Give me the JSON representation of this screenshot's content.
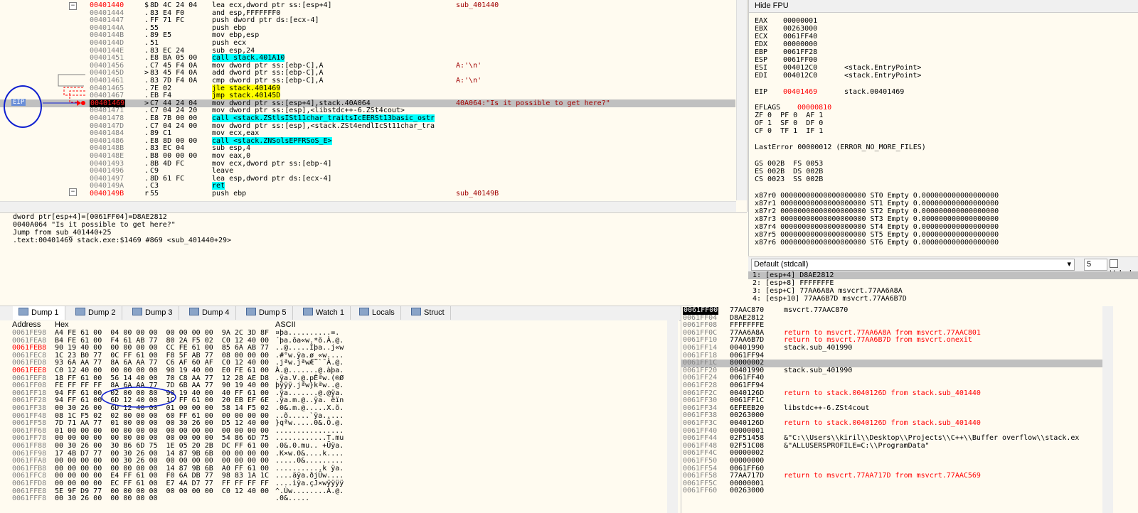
{
  "disasm": {
    "rows": [
      {
        "addr": "00401440",
        "addr_style": "red",
        "mark": "$",
        "bytes": "8D 4C 24 04",
        "instr": "lea ecx,dword ptr ss:[esp+4]",
        "cmt": "sub_401440",
        "hl": ""
      },
      {
        "addr": "00401444",
        "addr_style": "",
        "mark": ".",
        "bytes": "83 E4 F0",
        "instr": "and esp,FFFFFFF0",
        "cmt": "",
        "hl": ""
      },
      {
        "addr": "00401447",
        "addr_style": "",
        "mark": ".",
        "bytes": "FF 71 FC",
        "instr": "push dword ptr ds:[ecx-4]",
        "cmt": "",
        "hl": ""
      },
      {
        "addr": "0040144A",
        "addr_style": "",
        "mark": ".",
        "bytes": "55",
        "instr": "push ebp",
        "cmt": "",
        "hl": ""
      },
      {
        "addr": "0040144B",
        "addr_style": "",
        "mark": ".",
        "bytes": "89 E5",
        "instr": "mov ebp,esp",
        "cmt": "",
        "hl": ""
      },
      {
        "addr": "0040144D",
        "addr_style": "",
        "mark": ".",
        "bytes": "51",
        "instr": "push ecx",
        "cmt": "",
        "hl": ""
      },
      {
        "addr": "0040144E",
        "addr_style": "",
        "mark": ".",
        "bytes": "83 EC 24",
        "instr": "sub esp,24",
        "cmt": "",
        "hl": ""
      },
      {
        "addr": "00401451",
        "addr_style": "",
        "mark": ".",
        "bytes": "E8 BA 05 00",
        "instr": "call stack.401A10",
        "cmt": "",
        "hl": "call"
      },
      {
        "addr": "00401456",
        "addr_style": "",
        "mark": ".",
        "bytes": "C7 45 F4 0A",
        "instr": "mov dword ptr ss:[ebp-C],A",
        "cmt": "A:'\\n'",
        "hl": ""
      },
      {
        "addr": "0040145D",
        "addr_style": "",
        "mark": ">",
        "bytes": "83 45 F4 0A",
        "instr": "add dword ptr ss:[ebp-C],A",
        "cmt": "",
        "hl": ""
      },
      {
        "addr": "00401461",
        "addr_style": "",
        "mark": ".",
        "bytes": "83 7D F4 0A",
        "instr": "cmp dword ptr ss:[ebp-C],A",
        "cmt": "A:'\\n'",
        "hl": ""
      },
      {
        "addr": "00401465",
        "addr_style": "",
        "mark": ".",
        "bytes": "7E 02",
        "instr": "jle stack.401469",
        "cmt": "",
        "hl": "jmp"
      },
      {
        "addr": "00401467",
        "addr_style": "",
        "mark": ".",
        "bytes": "EB F4",
        "instr": "jmp stack.40145D",
        "cmt": "",
        "hl": "jmp"
      },
      {
        "addr": "00401469",
        "addr_style": "eip",
        "mark": ">",
        "bytes": "C7 44 24 04",
        "instr": "mov dword ptr ss:[esp+4],stack.40A064",
        "cmt": "40A064:\"Is it possible to get here?\"",
        "hl": "sel"
      },
      {
        "addr": "00401471",
        "addr_style": "",
        "mark": ".",
        "bytes": "C7 04 24 20",
        "instr": "mov dword ptr ss:[esp],<libstdc++-6.ZSt4cout>",
        "cmt": "",
        "hl": ""
      },
      {
        "addr": "00401478",
        "addr_style": "",
        "mark": ".",
        "bytes": "E8 7B 00 00",
        "instr": "call <stack.ZStlsISt11char_traitsIcEERSt13basic_ostr",
        "cmt": "",
        "hl": "call"
      },
      {
        "addr": "0040147D",
        "addr_style": "",
        "mark": ".",
        "bytes": "C7 04 24 00",
        "instr": "mov dword ptr ss:[esp],<stack.ZSt4endlIcSt11char_tra",
        "cmt": "",
        "hl": ""
      },
      {
        "addr": "00401484",
        "addr_style": "",
        "mark": ".",
        "bytes": "89 C1",
        "instr": "mov ecx,eax",
        "cmt": "",
        "hl": ""
      },
      {
        "addr": "00401486",
        "addr_style": "",
        "mark": ".",
        "bytes": "E8 8D 00 00",
        "instr": "call <stack.ZNSolsEPFRSoS_E>",
        "cmt": "",
        "hl": "call"
      },
      {
        "addr": "0040148B",
        "addr_style": "",
        "mark": ".",
        "bytes": "83 EC 04",
        "instr": "sub esp,4",
        "cmt": "",
        "hl": ""
      },
      {
        "addr": "0040148E",
        "addr_style": "",
        "mark": ".",
        "bytes": "B8 00 00 00",
        "instr": "mov eax,0",
        "cmt": "",
        "hl": ""
      },
      {
        "addr": "00401493",
        "addr_style": "",
        "mark": ".",
        "bytes": "8B 4D FC",
        "instr": "mov ecx,dword ptr ss:[ebp-4]",
        "cmt": "",
        "hl": ""
      },
      {
        "addr": "00401496",
        "addr_style": "",
        "mark": ".",
        "bytes": "C9",
        "instr": "leave",
        "cmt": "",
        "hl": ""
      },
      {
        "addr": "00401497",
        "addr_style": "",
        "mark": ".",
        "bytes": "8D 61 FC",
        "instr": "lea esp,dword ptr ds:[ecx-4]",
        "cmt": "",
        "hl": ""
      },
      {
        "addr": "0040149A",
        "addr_style": "",
        "mark": ".",
        "bytes": "C3",
        "instr": "ret",
        "cmt": "",
        "hl": "ret"
      },
      {
        "addr": "0040149B",
        "addr_style": "red",
        "mark": "r",
        "bytes": "55",
        "instr": "push ebp",
        "cmt": "sub_40149B",
        "hl": ""
      }
    ],
    "eip_label": "EIP"
  },
  "info": {
    "lines": [
      "dword ptr[esp+4]=[0061FF04]=D8AE2812",
      "0040A064 \"Is it possible to get here?\"",
      "Jump from sub_401440+25",
      ".text:00401469 stack.exe:$1469 #869 <sub_401440+29>"
    ]
  },
  "registers": {
    "header": "Hide FPU",
    "general": [
      {
        "name": "EAX",
        "value": "00000001",
        "note": ""
      },
      {
        "name": "EBX",
        "value": "00263000",
        "note": ""
      },
      {
        "name": "ECX",
        "value": "0061FF40",
        "note": ""
      },
      {
        "name": "EDX",
        "value": "00000000",
        "note": ""
      },
      {
        "name": "EBP",
        "value": "0061FF28",
        "note": ""
      },
      {
        "name": "ESP",
        "value": "0061FF00",
        "note": ""
      },
      {
        "name": "ESI",
        "value": "004012C0",
        "note": "<stack.EntryPoint>"
      },
      {
        "name": "EDI",
        "value": "004012C0",
        "note": "<stack.EntryPoint>"
      }
    ],
    "eip": {
      "name": "EIP",
      "value": "00401469",
      "note": "stack.00401469"
    },
    "eflags": {
      "name": "EFLAGS",
      "value": "00000810"
    },
    "flags": [
      "ZF 0  PF 0  AF 1",
      "OF 1  SF 0  DF 0",
      "CF 0  TF 1  IF 1"
    ],
    "lasterror": "LastError 00000012 (ERROR_NO_MORE_FILES)",
    "segs": [
      "GS 002B  FS 0053",
      "ES 002B  DS 002B",
      "CS 0023  SS 002B"
    ],
    "fpu": [
      "x87r0 00000000000000000000 ST0 Empty 0.000000000000000000",
      "x87r1 00000000000000000000 ST1 Empty 0.000000000000000000",
      "x87r2 00000000000000000000 ST2 Empty 0.000000000000000000",
      "x87r3 00000000000000000000 ST3 Empty 0.000000000000000000",
      "x87r4 00000000000000000000 ST4 Empty 0.000000000000000000",
      "x87r5 00000000000000000000 ST5 Empty 0.000000000000000000",
      "x87r6 00000000000000000000 ST6 Empty 0.000000000000000000"
    ]
  },
  "callconv": {
    "selected": "Default (stdcall)",
    "count": "5",
    "unlocked_label": "Unlocked",
    "args": [
      "1: [esp+4] D8AE2812",
      "2: [esp+8] FFFFFFFE",
      "3: [esp+C] 77AA6A8A msvcrt.77AA6A8A",
      "4: [esp+10] 77AA6B7D msvcrt.77AA6B7D"
    ]
  },
  "tabs": [
    {
      "label": "Dump 1",
      "active": true
    },
    {
      "label": "Dump 2",
      "active": false
    },
    {
      "label": "Dump 3",
      "active": false
    },
    {
      "label": "Dump 4",
      "active": false
    },
    {
      "label": "Dump 5",
      "active": false
    },
    {
      "label": "Watch 1",
      "active": false
    },
    {
      "label": "Locals",
      "active": false
    },
    {
      "label": "Struct",
      "active": false
    }
  ],
  "dump": {
    "headers": {
      "address": "Address",
      "hex": "Hex",
      "ascii": "ASCII"
    },
    "rows": [
      {
        "addr": "0061FE98",
        "red": false,
        "hex": "A4 FE 61 00  04 00 00 00  00 00 00 00  9A 2C 3D 8F",
        "ascii": "¤þa..........=."
      },
      {
        "addr": "0061FEA8",
        "red": false,
        "hex": "B4 FE 61 00  F4 61 AB 77  80 2A F5 02  C0 12 40 00",
        "ascii": "´þa.ôa«w.*õ.À.@."
      },
      {
        "addr": "0061FEB8",
        "red": true,
        "hex": "90 19 40 00  00 00 00 00  CC FE 61 00  85 6A AB 77",
        "ascii": "..@.....Ìþa..j«w"
      },
      {
        "addr": "0061FEC8",
        "red": false,
        "hex": "1C 23 B0 77  0C FF 61 00  F8 5F AB 77  08 00 00 00",
        "ascii": ".#°w.ÿa.ø_«w...."
      },
      {
        "addr": "0061FED8",
        "red": false,
        "hex": "93 6A AA 77  8A 6A AA 77  C6 AF 60 AF  C0 12 40 00",
        "ascii": ".jªw.jªwÆ¯`¯À.@."
      },
      {
        "addr": "0061FEE8",
        "red": true,
        "hex": "C0 12 40 00  00 00 00 00  90 19 40 00  E0 FE 61 00",
        "ascii": "À.@.......@.àþa."
      },
      {
        "addr": "0061FEF8",
        "red": false,
        "hex": "18 FF 61 00  56 14 40 00  70 C8 AA 77  12 28 AE D8",
        "ascii": ".ÿa.V.@.pÈªw.(®Ø"
      },
      {
        "addr": "0061FF08",
        "red": false,
        "hex": "FE FF FF FF  8A 6A AA 77  7D 6B AA 77  90 19 40 00",
        "ascii": "þÿÿÿ.jªw}kªw..@."
      },
      {
        "addr": "0061FF18",
        "red": false,
        "hex": "94 FF 61 00  02 00 00 80  90 19 40 00  40 FF 61 00",
        "ascii": ".ÿa.......@.@ÿa."
      },
      {
        "addr": "0061FF28",
        "red": false,
        "hex": "94 FF 61 00  6D 12 40 00  1C FF 61 00  20 EB EF 6E",
        "ascii": ".ÿa.m.@..ÿa. ëïn"
      },
      {
        "addr": "0061FF38",
        "red": false,
        "hex": "00 30 26 00  6D 12 40 00  01 00 00 00  58 14 F5 02",
        "ascii": ".0&.m.@.....X.õ."
      },
      {
        "addr": "0061FF48",
        "red": false,
        "hex": "08 1C F5 02  02 00 00 00  60 FF 61 00  00 00 00 00",
        "ascii": "..õ.....`ÿa....."
      },
      {
        "addr": "0061FF58",
        "red": false,
        "hex": "7D 71 AA 77  01 00 00 00  00 30 26 00  D5 12 40 00",
        "ascii": "}qªw.....0&.Õ.@."
      },
      {
        "addr": "0061FF68",
        "red": false,
        "hex": "01 00 00 00  00 00 00 00  00 00 00 00  00 00 00 00",
        "ascii": "................"
      },
      {
        "addr": "0061FF78",
        "red": false,
        "hex": "00 00 00 00  00 00 00 00  00 00 00 00  54 86 6D 75",
        "ascii": "............T.mu"
      },
      {
        "addr": "0061FF88",
        "red": false,
        "hex": "00 30 26 00  30 86 6D 75  1E 05 20 2B  DC FF 61 00",
        "ascii": ".0&.0.mu.. +Üÿa."
      },
      {
        "addr": "0061FF98",
        "red": false,
        "hex": "17 4B D7 77  00 30 26 00  14 87 9B 6B  00 00 00 00",
        "ascii": ".K×w.0&....k...."
      },
      {
        "addr": "0061FFA8",
        "red": false,
        "hex": "00 00 00 00  00 30 26 00  00 00 00 00  00 00 00 00",
        "ascii": ".....0&........."
      },
      {
        "addr": "0061FFB8",
        "red": false,
        "hex": "00 00 00 00  00 00 00 00  14 87 9B 6B  A0 FF 61 00",
        "ascii": "...........k ÿa."
      },
      {
        "addr": "0061FFC8",
        "red": false,
        "hex": "00 00 00 00  E4 FF 61 00  F0 6A DB 77  98 83 1A 1C",
        "ascii": "....äÿa.ðjÛw...."
      },
      {
        "addr": "0061FFD8",
        "red": false,
        "hex": "00 00 00 00  EC FF 61 00  E7 4A D7 77  FF FF FF FF",
        "ascii": "....ìÿa.çJ×wÿÿÿÿ"
      },
      {
        "addr": "0061FFE8",
        "red": false,
        "hex": "5E 9F D9 77  00 00 00 00  00 00 00 00  C0 12 40 00",
        "ascii": "^.Ùw........À.@."
      },
      {
        "addr": "0061FFF8",
        "red": false,
        "hex": "00 30 26 00  00 00 00 00",
        "ascii": ".0&....."
      }
    ]
  },
  "stack": {
    "rows": [
      {
        "addr": "0061FF00",
        "top": true,
        "value": "77AAC870",
        "cmt": "msvcrt.77AAC870",
        "red": false,
        "sel": false
      },
      {
        "addr": "0061FF04",
        "top": false,
        "value": "D8AE2812",
        "cmt": "",
        "red": false,
        "sel": false
      },
      {
        "addr": "0061FF08",
        "top": false,
        "value": "FFFFFFFE",
        "cmt": "",
        "red": false,
        "sel": false
      },
      {
        "addr": "0061FF0C",
        "top": false,
        "value": "77AA6A8A",
        "cmt": "return to msvcrt.77AA6A8A from msvcrt.77AAC801",
        "red": true,
        "sel": false
      },
      {
        "addr": "0061FF10",
        "top": false,
        "value": "77AA6B7D",
        "cmt": "return to msvcrt.77AA6B7D from msvcrt.onexit",
        "red": true,
        "sel": false
      },
      {
        "addr": "0061FF14",
        "top": false,
        "value": "00401990",
        "cmt": "stack.sub_401990",
        "red": false,
        "sel": false
      },
      {
        "addr": "0061FF18",
        "top": false,
        "value": "0061FF94",
        "cmt": "",
        "red": false,
        "sel": false
      },
      {
        "addr": "0061FF1C",
        "top": false,
        "value": "80000002",
        "cmt": "",
        "red": false,
        "sel": true
      },
      {
        "addr": "0061FF20",
        "top": false,
        "value": "00401990",
        "cmt": "stack.sub_401990",
        "red": false,
        "sel": false
      },
      {
        "addr": "0061FF24",
        "top": false,
        "value": "0061FF40",
        "cmt": "",
        "red": false,
        "sel": false
      },
      {
        "addr": "0061FF28",
        "top": false,
        "value": "0061FF94",
        "cmt": "",
        "red": false,
        "sel": false
      },
      {
        "addr": "0061FF2C",
        "top": false,
        "value": "0040126D",
        "cmt": "return to stack.0040126D from stack.sub_401440",
        "red": true,
        "sel": false
      },
      {
        "addr": "0061FF30",
        "top": false,
        "value": "0061FF1C",
        "cmt": "",
        "red": false,
        "sel": false
      },
      {
        "addr": "0061FF34",
        "top": false,
        "value": "6EFEEB20",
        "cmt": "libstdc++-6.ZSt4cout",
        "red": false,
        "sel": false
      },
      {
        "addr": "0061FF38",
        "top": false,
        "value": "00263000",
        "cmt": "",
        "red": false,
        "sel": false
      },
      {
        "addr": "0061FF3C",
        "top": false,
        "value": "0040126D",
        "cmt": "return to stack.0040126D from stack.sub_401440",
        "red": true,
        "sel": false
      },
      {
        "addr": "0061FF40",
        "top": false,
        "value": "00000001",
        "cmt": "",
        "red": false,
        "sel": false
      },
      {
        "addr": "0061FF44",
        "top": false,
        "value": "02F51458",
        "cmt": "&\"C:\\\\Users\\\\kiril\\\\Desktop\\\\Projects\\\\C++\\\\Buffer overflow\\\\stack.ex",
        "red": false,
        "sel": false
      },
      {
        "addr": "0061FF48",
        "top": false,
        "value": "02F51C08",
        "cmt": "&\"ALLUSERSPROFILE=C:\\\\ProgramData\"",
        "red": false,
        "sel": false
      },
      {
        "addr": "0061FF4C",
        "top": false,
        "value": "00000002",
        "cmt": "",
        "red": false,
        "sel": false
      },
      {
        "addr": "0061FF50",
        "top": false,
        "value": "00000000",
        "cmt": "",
        "red": false,
        "sel": false
      },
      {
        "addr": "0061FF54",
        "top": false,
        "value": "0061FF60",
        "cmt": "",
        "red": false,
        "sel": false
      },
      {
        "addr": "0061FF58",
        "top": false,
        "value": "77AA717D",
        "cmt": "return to msvcrt.77AA717D from msvcrt.77AAC569",
        "red": true,
        "sel": false
      },
      {
        "addr": "0061FF5C",
        "top": false,
        "value": "00000001",
        "cmt": "",
        "red": false,
        "sel": false
      },
      {
        "addr": "0061FF60",
        "top": false,
        "value": "00263000",
        "cmt": "",
        "red": false,
        "sel": false
      }
    ]
  }
}
